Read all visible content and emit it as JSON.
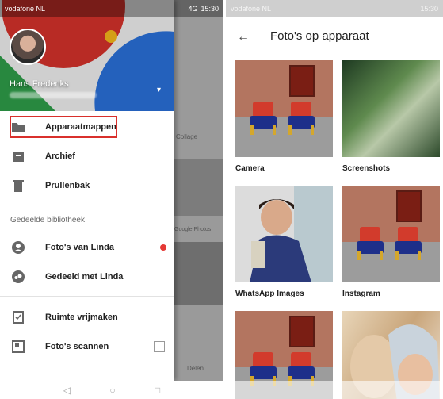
{
  "left_status": {
    "carrier": "vodafone NL",
    "time": "15:30",
    "signal": "4G"
  },
  "drawer": {
    "user_name": "Hans Fredenks",
    "items": [
      {
        "label": "Apparaatmappen",
        "icon": "folder-icon"
      },
      {
        "label": "Archief",
        "icon": "archive-icon"
      },
      {
        "label": "Prullenbak",
        "icon": "trash-icon"
      }
    ],
    "section_title": "Gedeelde bibliotheek",
    "shared_items": [
      {
        "label": "Foto's van Linda",
        "icon": "person-icon"
      },
      {
        "label": "Gedeeld met Linda",
        "icon": "shared-icon"
      }
    ],
    "tools": [
      {
        "label": "Ruimte vrijmaken",
        "icon": "free-space-icon"
      },
      {
        "label": "Foto's scannen",
        "icon": "scan-icon"
      }
    ]
  },
  "background_app": {
    "collage_label": "Collage",
    "photos_label": "Google Photos",
    "delen_label": "Delen"
  },
  "right_status": {
    "carrier": "vodafone NL",
    "time": "15:30"
  },
  "folder_view": {
    "title": "Foto's op apparaat",
    "albums": [
      {
        "label": "Camera"
      },
      {
        "label": "Screenshots"
      },
      {
        "label": "WhatsApp Images"
      },
      {
        "label": "Instagram"
      }
    ]
  },
  "colors": {
    "highlight": "#d9302c",
    "dot": "#e53935"
  }
}
